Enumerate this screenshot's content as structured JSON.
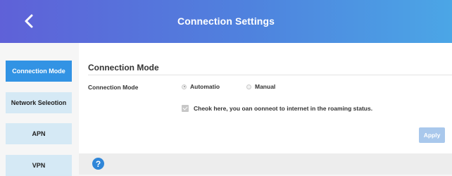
{
  "header": {
    "title": "Connection Settings",
    "back_icon": "chevron-left-icon"
  },
  "sidebar": {
    "items": [
      {
        "label": "Connection Mode",
        "active": true
      },
      {
        "label": "Network Seleotion",
        "active": false
      },
      {
        "label": "APN",
        "active": false
      },
      {
        "label": "VPN",
        "active": false
      }
    ]
  },
  "main": {
    "section_title": "Connection Mode",
    "field_label": "Connection Mode",
    "radio_options": [
      {
        "label": "Automatio",
        "selected": true
      },
      {
        "label": "Manual",
        "selected": false
      }
    ],
    "roaming_checkbox": {
      "label": "Cheok here, you oan oonneot to internet in the roaming status.",
      "checked": true
    },
    "apply_label": "Apply"
  },
  "footer": {
    "help_icon": "help-icon",
    "help_symbol": "?"
  },
  "colors": {
    "header_gradient_start": "#5f61d8",
    "header_gradient_end": "#4ba6e6",
    "active_tab": "#3293e4",
    "inactive_tab": "#d5e9f5",
    "apply_button": "#a9c8ec"
  }
}
